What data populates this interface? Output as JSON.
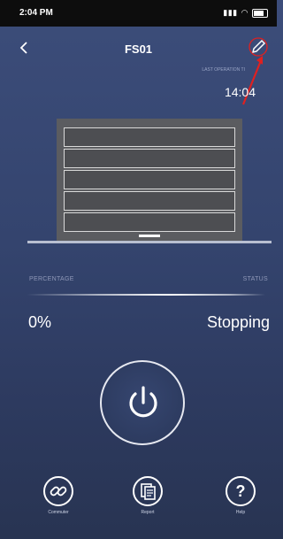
{
  "status_bar": {
    "time": "2:04 PM",
    "icons": [
      "signal-icon",
      "wifi-icon",
      "battery-icon"
    ]
  },
  "header": {
    "title": "FS01",
    "back_icon": "chevron-left-icon",
    "edit_icon": "pencil-icon"
  },
  "last_operation": {
    "label": "LAST OPERATION TI",
    "time": "14:04"
  },
  "door": {
    "panels": 5,
    "accent": "#d9d9d9"
  },
  "status": {
    "percentage_label": "PERCENTAGE",
    "status_label": "STATUS",
    "percentage_value": "0%",
    "status_value": "Stopping"
  },
  "power_button": {
    "icon": "power-icon"
  },
  "nav": {
    "commuter": {
      "label": "Commuter",
      "icon": "link-icon"
    },
    "report": {
      "label": "Report",
      "icon": "report-icon"
    },
    "help": {
      "label": "Help",
      "icon": "question-icon",
      "glyph": "?"
    }
  },
  "colors": {
    "background_top": "#3c4d7a",
    "background_bottom": "#283452",
    "annotation": "#e02020"
  }
}
